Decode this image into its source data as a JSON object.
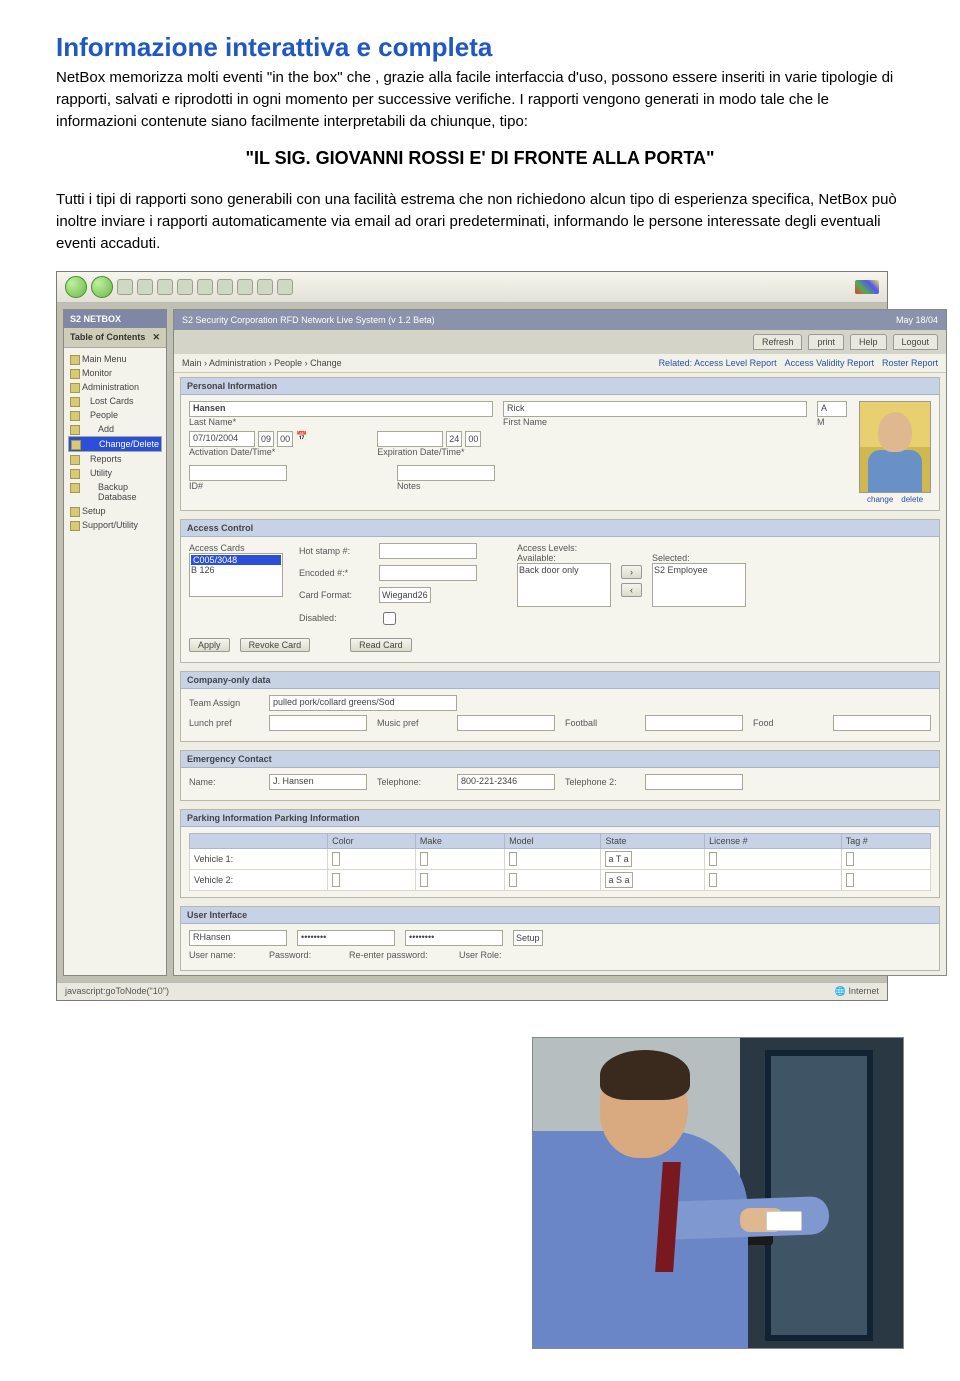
{
  "title": "Informazione interattiva e completa",
  "p1": "NetBox memorizza molti eventi \"in the box\" che , grazie alla facile interfaccia d'uso, possono essere inseriti in varie tipologie di rapporti, salvati e riprodotti in ogni momento per successive verifiche. I rapporti vengono generati in modo tale che le informazioni contenute siano facilmente interpretabili da chiunque, tipo:",
  "quote": "\"IL SIG. GIOVANNI ROSSI E' DI FRONTE ALLA PORTA\"",
  "p2": "Tutti i tipi di rapporti sono generabili con una facilità estrema che non richiedono alcun tipo di esperienza specifica, NetBox può inoltre inviare i rapporti automaticamente via email ad orari predeterminati, informando le persone interessate degli eventuali eventi accaduti.",
  "screenshot": {
    "sidebar_header": "S2 NETBOX",
    "toc_header": "Table of Contents",
    "sidebar_items": [
      "Main Menu",
      "Monitor",
      "Administration",
      "Lost Cards",
      "People",
      "Add",
      "Change/Delete",
      "Reports",
      "Utility",
      "Backup Database",
      "Setup",
      "Support/Utility"
    ],
    "selected_item": "Change/Delete",
    "app_title": "S2 Security Corporation RFD Network Live System (v 1.2 Beta)",
    "tabs": [
      "Refresh",
      "print",
      "Help",
      "Logout"
    ],
    "breadcrumb": "Main › Administration › People › Change",
    "related_links": [
      "Related: Access Level Report",
      "Access Validity Report",
      "Roster Report"
    ],
    "sections": {
      "personal": {
        "title": "Personal Information",
        "last_name_lbl": "Last Name*",
        "last_name": "Hansen",
        "first_name_lbl": "First Name",
        "first_name": "Rick",
        "mi_lbl": "M",
        "mi": "A",
        "act_date_lbl": "Activation Date/Time*",
        "act_date": "07/10/2004",
        "act_hh": "09",
        "act_mm": "00",
        "exp_date_lbl": "Expiration Date/Time*",
        "exp_hh": "24",
        "exp_mm": "00",
        "id_lbl": "ID#",
        "notes_lbl": "Notes",
        "photo_change": "change",
        "photo_delete": "delete"
      },
      "access": {
        "title": "Access Control",
        "cards_lbl": "Access Cards",
        "card_row1": "C005/3048",
        "card_row2": "B 126",
        "hot_lbl": "Hot stamp #:",
        "enc_lbl": "Encoded #:*",
        "fmt_lbl": "Card Format:",
        "fmt_val": "Wiegand26",
        "dis_lbl": "Disabled:",
        "levels_lbl": "Access Levels:",
        "avail_lbl": "Available:",
        "avail_val": "Back door only",
        "sel_lbl": "Selected:",
        "sel_val": "S2 Employee",
        "btn_apply": "Apply",
        "btn_revoke": "Revoke Card",
        "btn_read": "Read Card"
      },
      "company": {
        "title": "Company-only data",
        "team_lbl": "Team Assign",
        "team_val": "pulled pork/collard greens/Sod",
        "lunch_lbl": "Lunch pref",
        "music_lbl": "Music pref",
        "foot_lbl": "Football",
        "food_lbl": "Food"
      },
      "emergency": {
        "title": "Emergency Contact",
        "name_lbl": "Name:",
        "name_val": "J. Hansen",
        "tel_lbl": "Telephone:",
        "tel_val": "800-221-2346",
        "tel2_lbl": "Telephone 2:"
      },
      "parking": {
        "title": "Parking Information Parking Information",
        "cols": [
          "Color",
          "Make",
          "Model",
          "State",
          "License #",
          "Tag #"
        ],
        "row1_lbl": "Vehicle 1:",
        "row2_lbl": "Vehicle 2:",
        "sel1": "a T a",
        "sel2": "a S a"
      },
      "userif": {
        "title": "User Interface",
        "user": "RHansen",
        "user_lbl": "User name:",
        "pw_lbl": "Password:",
        "pw2_lbl": "Re-enter password:",
        "role_lbl": "User Role:",
        "role_val": "Setup",
        "pw_mask": "••••••••"
      }
    },
    "statusbar_left": "javascript:goToNode(\"10\")",
    "statusbar_right": "Internet"
  }
}
